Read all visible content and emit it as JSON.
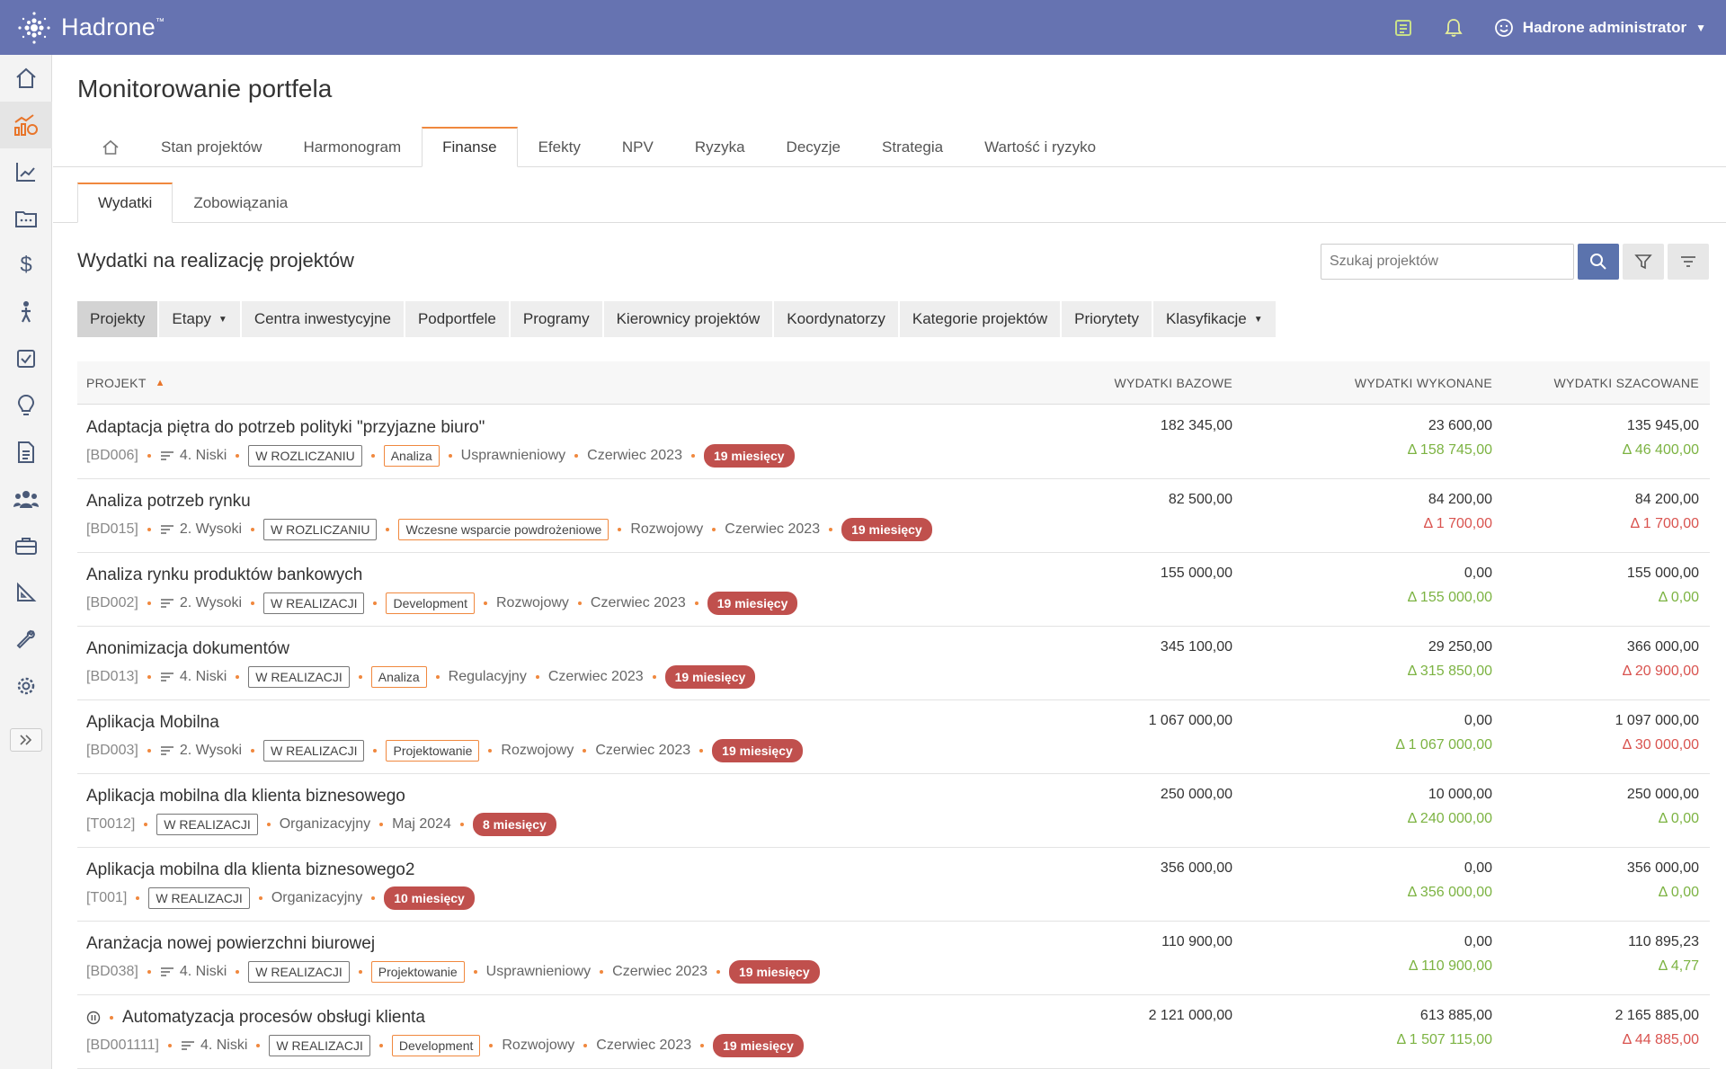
{
  "app": {
    "brand": "Hadrone",
    "user_name": "Hadrone administrator",
    "icons": {
      "logo": "hadrone-logo-icon",
      "notes": "notes-icon",
      "bell": "bell-icon",
      "user": "smile-user-icon"
    }
  },
  "sidebar": {
    "items": [
      {
        "name": "home-icon"
      },
      {
        "name": "portfolio-monitor-icon",
        "active": true
      },
      {
        "name": "chart-icon"
      },
      {
        "name": "folder-icon"
      },
      {
        "name": "dollar-icon"
      },
      {
        "name": "person-icon"
      },
      {
        "name": "checkbox-icon"
      },
      {
        "name": "lightbulb-icon"
      },
      {
        "name": "document-icon"
      },
      {
        "name": "people-icon"
      },
      {
        "name": "briefcase-icon"
      },
      {
        "name": "ruler-icon"
      },
      {
        "name": "wrench-icon"
      },
      {
        "name": "gear-icon"
      }
    ],
    "expand_icon": "double-chevron-right-icon"
  },
  "page": {
    "title": "Monitorowanie portfela"
  },
  "tabs": {
    "home_icon": "home-icon",
    "items": [
      "Stan projektów",
      "Harmonogram",
      "Finanse",
      "Efekty",
      "NPV",
      "Ryzyka",
      "Decyzje",
      "Strategia",
      "Wartość i ryzyko"
    ],
    "active": "Finanse"
  },
  "subtabs": {
    "items": [
      "Wydatki",
      "Zobowiązania"
    ],
    "active": "Wydatki"
  },
  "section": {
    "title": "Wydatki na realizację projektów"
  },
  "search": {
    "placeholder": "Szukaj projektów"
  },
  "grouping": {
    "items": [
      "Projekty",
      "Etapy",
      "Centra inwestycyjne",
      "Podportfele",
      "Programy",
      "Kierownicy projektów",
      "Koordynatorzy",
      "Kategorie projektów",
      "Priorytety",
      "Klasyfikacje"
    ],
    "dropdowns": [
      "Etapy",
      "Klasyfikacje"
    ],
    "active": "Projekty"
  },
  "table": {
    "headers": {
      "project": "PROJEKT",
      "base": "WYDATKI BAZOWE",
      "done": "WYDATKI WYKONANE",
      "est": "WYDATKI SZACOWANE"
    },
    "rows": [
      {
        "title": "Adaptacja piętra do potrzeb polityki \"przyjazne biuro\"",
        "code": "[BD006]",
        "priority": "4. Niski",
        "status": "W ROZLICZANIU",
        "stage": "Analiza",
        "category": "Usprawnieniowy",
        "date": "Czerwiec 2023",
        "duration": "19 miesięcy",
        "base": "182 345,00",
        "done": "23 600,00",
        "done_delta": "Δ 158 745,00",
        "done_delta_type": "pos",
        "est": "135 945,00",
        "est_delta": "Δ 46 400,00",
        "est_delta_type": "pos"
      },
      {
        "title": "Analiza potrzeb rynku",
        "code": "[BD015]",
        "priority": "2. Wysoki",
        "status": "W ROZLICZANIU",
        "stage": "Wczesne wsparcie powdrożeniowe",
        "category": "Rozwojowy",
        "date": "Czerwiec 2023",
        "duration": "19 miesięcy",
        "base": "82 500,00",
        "done": "84 200,00",
        "done_delta": "Δ 1 700,00",
        "done_delta_type": "neg",
        "est": "84 200,00",
        "est_delta": "Δ 1 700,00",
        "est_delta_type": "neg"
      },
      {
        "title": "Analiza rynku produktów bankowych",
        "code": "[BD002]",
        "priority": "2. Wysoki",
        "status": "W REALIZACJI",
        "stage": "Development",
        "category": "Rozwojowy",
        "date": "Czerwiec 2023",
        "duration": "19 miesięcy",
        "base": "155 000,00",
        "done": "0,00",
        "done_delta": "Δ 155 000,00",
        "done_delta_type": "pos",
        "est": "155 000,00",
        "est_delta": "Δ 0,00",
        "est_delta_type": "pos"
      },
      {
        "title": "Anonimizacja dokumentów",
        "code": "[BD013]",
        "priority": "4. Niski",
        "status": "W REALIZACJI",
        "stage": "Analiza",
        "category": "Regulacyjny",
        "date": "Czerwiec 2023",
        "duration": "19 miesięcy",
        "base": "345 100,00",
        "done": "29 250,00",
        "done_delta": "Δ 315 850,00",
        "done_delta_type": "pos",
        "est": "366 000,00",
        "est_delta": "Δ 20 900,00",
        "est_delta_type": "neg"
      },
      {
        "title": "Aplikacja Mobilna",
        "code": "[BD003]",
        "priority": "2. Wysoki",
        "status": "W REALIZACJI",
        "stage": "Projektowanie",
        "category": "Rozwojowy",
        "date": "Czerwiec 2023",
        "duration": "19 miesięcy",
        "base": "1 067 000,00",
        "done": "0,00",
        "done_delta": "Δ 1 067 000,00",
        "done_delta_type": "pos",
        "est": "1 097 000,00",
        "est_delta": "Δ 30 000,00",
        "est_delta_type": "neg"
      },
      {
        "title": "Aplikacja mobilna dla klienta biznesowego",
        "code": "[T0012]",
        "priority": "",
        "status": "W REALIZACJI",
        "stage": "",
        "category": "Organizacyjny",
        "date": "Maj 2024",
        "duration": "8 miesięcy",
        "base": "250 000,00",
        "done": "10 000,00",
        "done_delta": "Δ 240 000,00",
        "done_delta_type": "pos",
        "est": "250 000,00",
        "est_delta": "Δ 0,00",
        "est_delta_type": "pos"
      },
      {
        "title": "Aplikacja mobilna dla klienta biznesowego2",
        "code": "[T001]",
        "priority": "",
        "status": "W REALIZACJI",
        "stage": "",
        "category": "Organizacyjny",
        "date": "",
        "duration": "10 miesięcy",
        "base": "356 000,00",
        "done": "0,00",
        "done_delta": "Δ 356 000,00",
        "done_delta_type": "pos",
        "est": "356 000,00",
        "est_delta": "Δ 0,00",
        "est_delta_type": "pos"
      },
      {
        "title": "Aranżacja nowej powierzchni biurowej",
        "code": "[BD038]",
        "priority": "4. Niski",
        "status": "W REALIZACJI",
        "stage": "Projektowanie",
        "category": "Usprawnieniowy",
        "date": "Czerwiec 2023",
        "duration": "19 miesięcy",
        "base": "110 900,00",
        "done": "0,00",
        "done_delta": "Δ 110 900,00",
        "done_delta_type": "pos",
        "est": "110 895,23",
        "est_delta": "Δ 4,77",
        "est_delta_type": "pos"
      },
      {
        "title": "Automatyzacja procesów obsługi klienta",
        "paused": true,
        "code": "[BD001111]",
        "priority": "4. Niski",
        "status": "W REALIZACJI",
        "stage": "Development",
        "category": "Rozwojowy",
        "date": "Czerwiec 2023",
        "duration": "19 miesięcy",
        "base": "2 121 000,00",
        "done": "613 885,00",
        "done_delta": "Δ 1 507 115,00",
        "done_delta_type": "pos",
        "est": "2 165 885,00",
        "est_delta": "Δ 44 885,00",
        "est_delta_type": "neg"
      }
    ]
  }
}
